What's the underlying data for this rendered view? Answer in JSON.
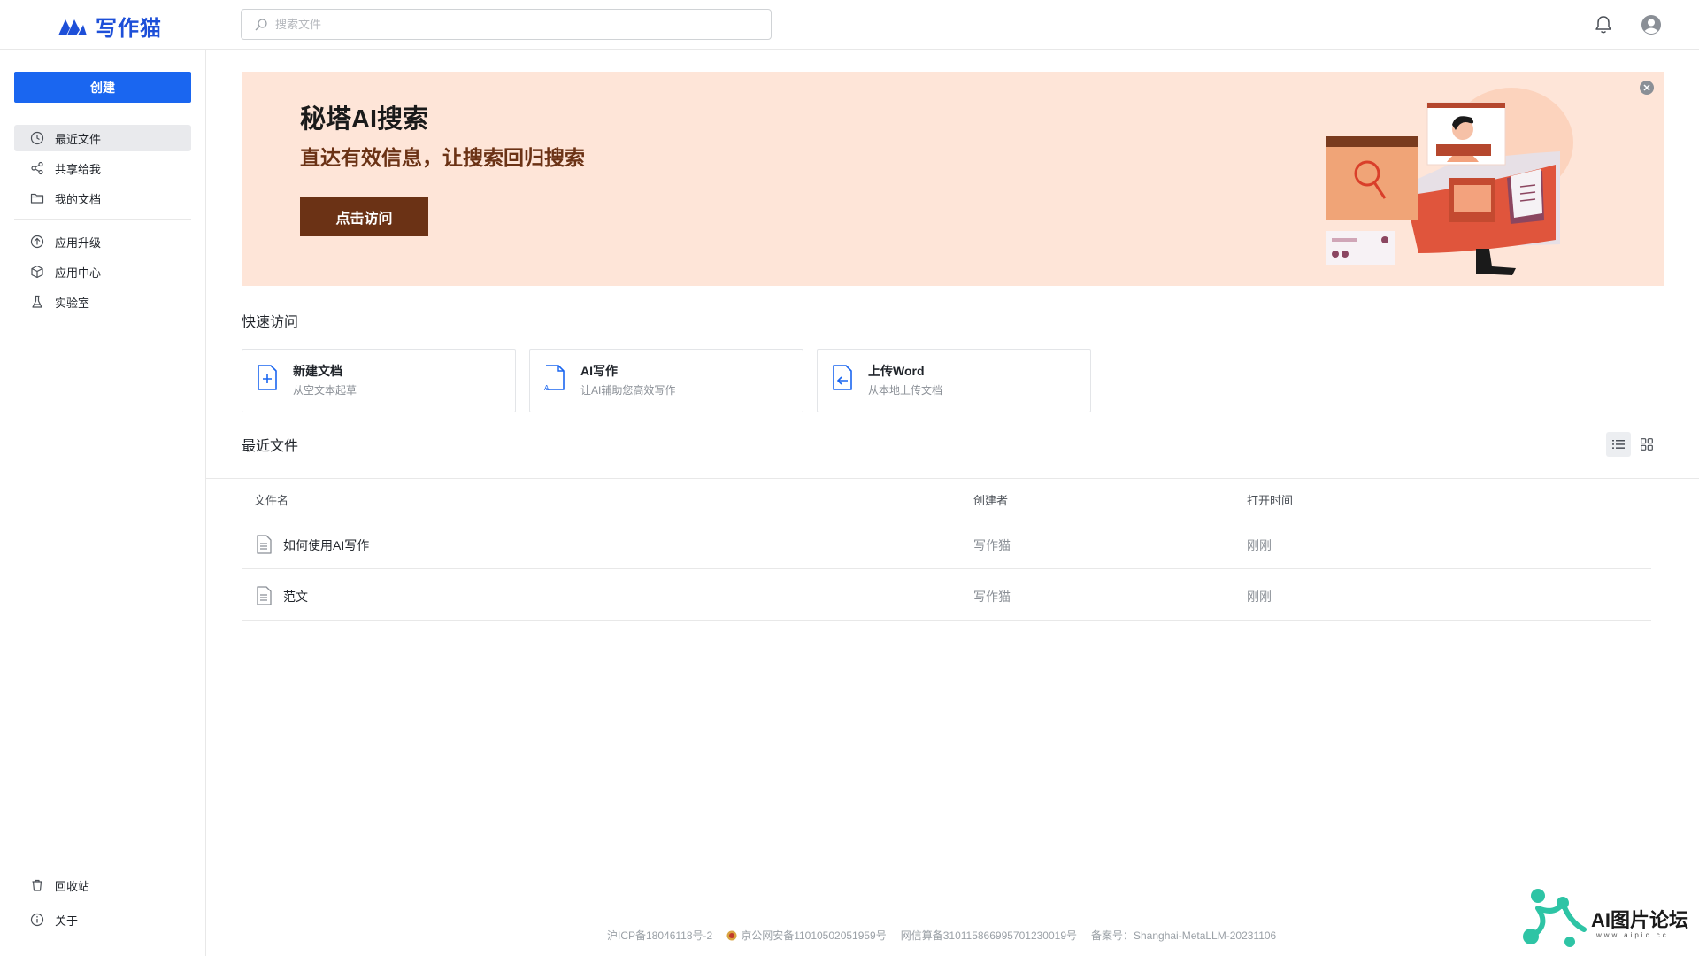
{
  "app": {
    "logo_text": "写作猫",
    "brand_color": "#1d4fd8",
    "accent_color": "#1a66f0"
  },
  "search": {
    "placeholder": "搜索文件",
    "value": ""
  },
  "header_icons": [
    "bell-icon",
    "user-avatar-icon"
  ],
  "sidebar": {
    "create_label": "创建",
    "items": [
      {
        "label": "最近文件",
        "icon": "clock-icon",
        "active": true
      },
      {
        "label": "共享给我",
        "icon": "share-icon",
        "active": false
      },
      {
        "label": "我的文档",
        "icon": "folder-icon",
        "active": false
      },
      {
        "label": "应用升级",
        "icon": "upgrade-icon",
        "active": false
      },
      {
        "label": "应用中心",
        "icon": "cube-icon",
        "active": false
      },
      {
        "label": "实验室",
        "icon": "flask-icon",
        "active": false
      }
    ],
    "bottom_items": [
      {
        "label": "回收站",
        "icon": "trash-icon"
      },
      {
        "label": "关于",
        "icon": "info-icon"
      }
    ]
  },
  "banner": {
    "title": "秘塔AI搜索",
    "subtitle": "直达有效信息，让搜索回归搜索",
    "button_label": "点击访问",
    "bg_color": "#fee5d8",
    "button_color": "#6b3215"
  },
  "quick_access": {
    "title": "快速访问",
    "cards": [
      {
        "title": "新建文档",
        "desc": "从空文本起草",
        "icon": "new-doc-icon"
      },
      {
        "title": "AI写作",
        "desc": "让AI辅助您高效写作",
        "icon": "ai-doc-icon"
      },
      {
        "title": "上传Word",
        "desc": "从本地上传文档",
        "icon": "upload-doc-icon"
      }
    ]
  },
  "recent": {
    "title": "最近文件",
    "view_modes": [
      "list-view-icon",
      "grid-view-icon"
    ],
    "active_view": "list",
    "columns": [
      "文件名",
      "创建者",
      "打开时间"
    ],
    "rows": [
      {
        "name": "如何使用AI写作",
        "creator": "写作猫",
        "opened": "刚刚"
      },
      {
        "name": "范文",
        "creator": "写作猫",
        "opened": "刚刚"
      }
    ]
  },
  "footer": {
    "icp": "沪ICP备18046118号-2",
    "police": "京公网安备11010502051959号",
    "algo": "网信算备310115866995701230019号",
    "record": "备案号：Shanghai-MetaLLM-20231106"
  },
  "watermark": {
    "text": "AI图片论坛",
    "url": "www.aipic.cc"
  }
}
